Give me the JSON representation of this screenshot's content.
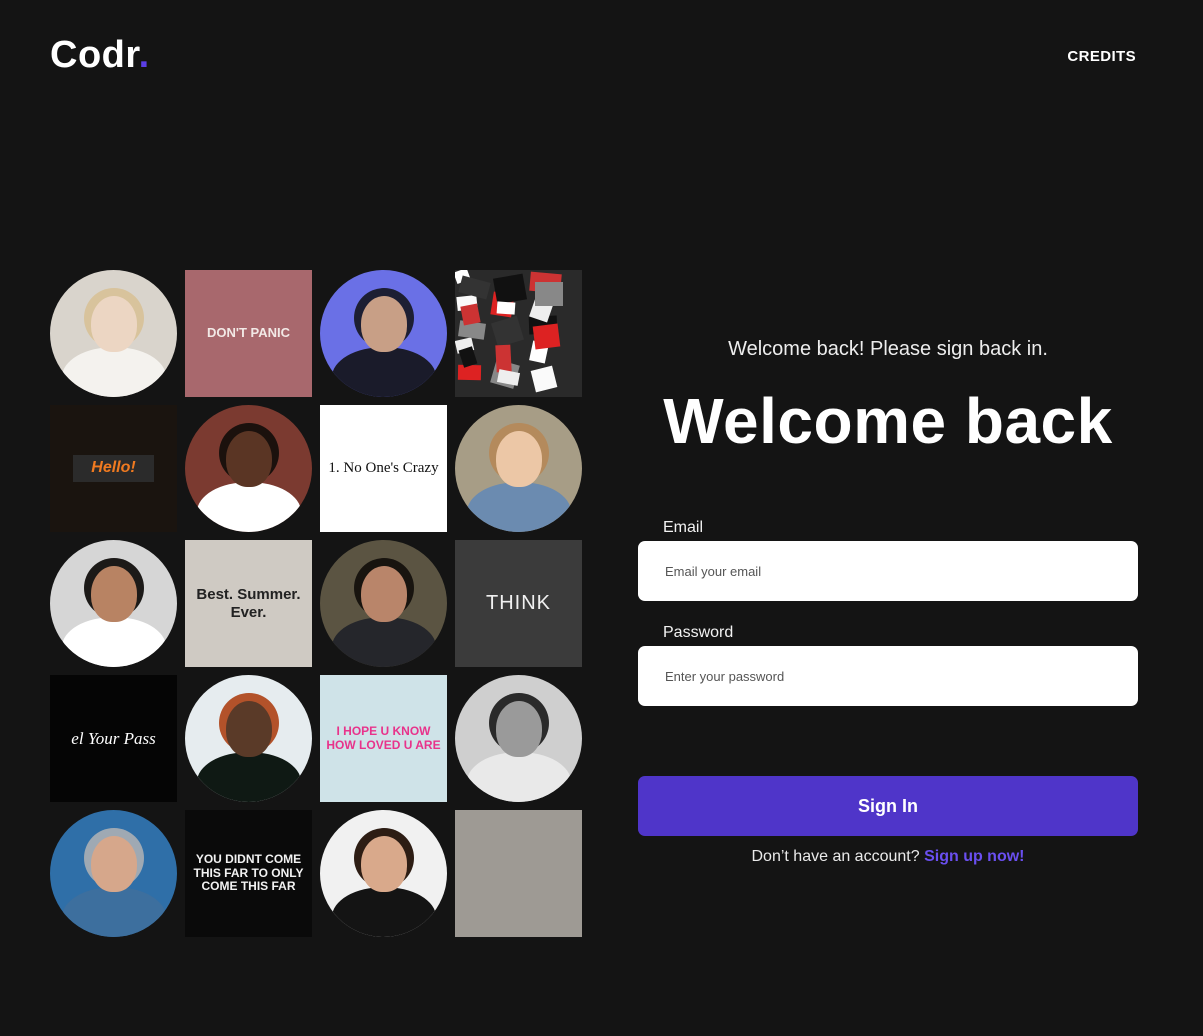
{
  "header": {
    "logo_text": "Codr",
    "logo_dot": ".",
    "credits_label": "CREDITS"
  },
  "gallery": {
    "tiles": [
      {
        "kind": "portrait",
        "shape": "circle",
        "bg": "#d9d4cc",
        "hair": "#d8c39c",
        "skin": "#ecd6c3",
        "shirt": "#f4f2ee",
        "caption": ""
      },
      {
        "kind": "text",
        "shape": "square",
        "bg": "#a8686d",
        "fg": "#f2e9e6",
        "caption": "DON'T PANIC",
        "size": 13
      },
      {
        "kind": "portrait",
        "shape": "circle",
        "bg": "#6a70e6",
        "hair": "#1d1f33",
        "skin": "#c89f86",
        "shirt": "#1a1b2a",
        "caption": ""
      },
      {
        "kind": "collage",
        "shape": "square",
        "bg": "#2a2a2a",
        "caption": ""
      },
      {
        "kind": "text",
        "shape": "square",
        "bg": "#1a140f",
        "fg": "#f07a20",
        "caption": "Hello!",
        "size": 16
      },
      {
        "kind": "portrait",
        "shape": "circle",
        "bg": "#7b3a30",
        "hair": "#1b110d",
        "skin": "#5a3524",
        "shirt": "#ffffff",
        "caption": ""
      },
      {
        "kind": "text",
        "shape": "square",
        "bg": "#ffffff",
        "fg": "#111111",
        "caption": "1. No One's Crazy",
        "size": 15
      },
      {
        "kind": "portrait",
        "shape": "circle",
        "bg": "#a79d86",
        "hair": "#b48a5c",
        "skin": "#ecc7a6",
        "shirt": "#6b8bb0",
        "caption": ""
      },
      {
        "kind": "portrait",
        "shape": "circle",
        "bg": "#d6d6d6",
        "hair": "#1c1a18",
        "skin": "#b88363",
        "shirt": "#ffffff",
        "caption": ""
      },
      {
        "kind": "text",
        "shape": "square",
        "bg": "#cfcac3",
        "fg": "#222222",
        "caption": "Best. Summer. Ever.",
        "size": 15
      },
      {
        "kind": "portrait",
        "shape": "circle",
        "bg": "#5b5442",
        "hair": "#18140f",
        "skin": "#b9856a",
        "shirt": "#25262b",
        "caption": ""
      },
      {
        "kind": "text",
        "shape": "square",
        "bg": "#3b3b3b",
        "fg": "#f0f0f0",
        "caption": "THINK",
        "size": 20
      },
      {
        "kind": "text",
        "shape": "square",
        "bg": "#050505",
        "fg": "#ffffff",
        "caption": "el Your Pass",
        "size": 17
      },
      {
        "kind": "portrait",
        "shape": "circle",
        "bg": "#e6ecef",
        "hair": "#b3522a",
        "skin": "#5a3a28",
        "shirt": "#0f1914",
        "caption": ""
      },
      {
        "kind": "text",
        "shape": "square",
        "bg": "#cfe3e8",
        "fg": "#e8338b",
        "caption": "I HOPE U KNOW HOW LOVED U ARE",
        "size": 12
      },
      {
        "kind": "portrait",
        "shape": "circle",
        "bg": "#cfcfcf",
        "hair": "#2a2a2a",
        "skin": "#9a9a9a",
        "shirt": "#e9e9e9",
        "caption": ""
      },
      {
        "kind": "portrait",
        "shape": "circle",
        "bg": "#2f6fa8",
        "hair": "#9fa9b3",
        "skin": "#d6a78b",
        "shirt": "#3d6f9e",
        "caption": ""
      },
      {
        "kind": "text",
        "shape": "square",
        "bg": "#0a0a0a",
        "fg": "#f2f2f2",
        "caption": "YOU DIDNT COME THIS FAR TO ONLY COME THIS FAR",
        "size": 12
      },
      {
        "kind": "portrait",
        "shape": "circle",
        "bg": "#f1f1f1",
        "hair": "#2d1d14",
        "skin": "#d9a98b",
        "shirt": "#141414",
        "caption": ""
      },
      {
        "kind": "text",
        "shape": "square",
        "bg": "#9e9a94",
        "fg": "#555555",
        "caption": "",
        "size": 5
      }
    ]
  },
  "form": {
    "subtitle": "Welcome back! Please sign back in.",
    "title": "Welcome back",
    "email_label": "Email",
    "email_placeholder": "Email your email",
    "password_label": "Password",
    "password_placeholder": "Enter your password",
    "submit_label": "Sign In",
    "signup_prompt": "Don’t have an account?",
    "signup_link": "Sign up now!"
  },
  "colors": {
    "background": "#141414",
    "accent": "#4f35c9",
    "link": "#6a4ff0",
    "input_bg": "#ffffff"
  }
}
